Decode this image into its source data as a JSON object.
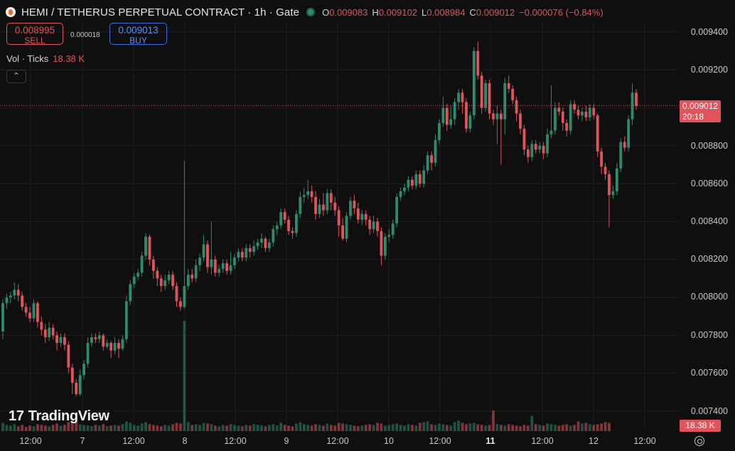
{
  "header": {
    "title": "HEMI / TETHERUS PERPETUAL CONTRACT · 1h · Gate",
    "ohlc": [
      {
        "key": "O",
        "value": "0.009083"
      },
      {
        "key": "H",
        "value": "0.009102"
      },
      {
        "key": "L",
        "value": "0.008984"
      },
      {
        "key": "C",
        "value": "0.009012"
      }
    ],
    "change": "−0.000076 (−0.84%)"
  },
  "trade": {
    "sell_price": "0.008995",
    "sell_label": "SELL",
    "spread": "0.000018",
    "buy_price": "0.009013",
    "buy_label": "BUY"
  },
  "volume_legend": {
    "label": "Vol · Ticks",
    "value": "18.38 K"
  },
  "collapse_icon": "chevron-up-icon",
  "price_axis": {
    "labels": [
      "0.009400",
      "0.009200",
      "0.008800",
      "0.008600",
      "0.008400",
      "0.008200",
      "0.008000",
      "0.007800",
      "0.007600",
      "0.007400"
    ]
  },
  "last_price_tag": {
    "price": "0.009012",
    "countdown": "20:18"
  },
  "volume_tag": "18.38 K",
  "time_axis": {
    "labels": [
      "12:00",
      "7",
      "12:00",
      "8",
      "12:00",
      "9",
      "12:00",
      "10",
      "12:00",
      "11",
      "12:00",
      "12",
      "12:00"
    ]
  },
  "brand": "TradingView",
  "settings_icon": "gear-icon",
  "colors": {
    "up": "#2e8b6e",
    "down": "#e0555c",
    "background": "#0f0f0f",
    "grid": "#1e1e1e"
  },
  "chart_data": {
    "type": "candlestick",
    "title": "HEMI / TETHERUS PERPETUAL CONTRACT · 1h · Gate",
    "ylim": [
      0.0073,
      0.0095
    ],
    "last_price": 0.009012,
    "candles": [
      [
        0.00782,
        0.00797,
        0.00799,
        0.00778
      ],
      [
        0.00797,
        0.008,
        0.00802,
        0.00794
      ],
      [
        0.008,
        0.00801,
        0.00803,
        0.00797
      ],
      [
        0.00801,
        0.00804,
        0.00808,
        0.00799
      ],
      [
        0.00804,
        0.00801,
        0.00807,
        0.00798
      ],
      [
        0.00801,
        0.00795,
        0.00803,
        0.00793
      ],
      [
        0.00795,
        0.00792,
        0.00797,
        0.0079
      ],
      [
        0.00792,
        0.00789,
        0.00795,
        0.00787
      ],
      [
        0.00789,
        0.00797,
        0.00799,
        0.00787
      ],
      [
        0.00797,
        0.00787,
        0.00798,
        0.00784
      ],
      [
        0.00787,
        0.00783,
        0.0079,
        0.0078
      ],
      [
        0.00783,
        0.00779,
        0.00786,
        0.00776
      ],
      [
        0.00779,
        0.00784,
        0.00787,
        0.00777
      ],
      [
        0.00784,
        0.0078,
        0.00786,
        0.00778
      ],
      [
        0.0078,
        0.00776,
        0.00782,
        0.00772
      ],
      [
        0.00776,
        0.00779,
        0.00781,
        0.00774
      ],
      [
        0.00779,
        0.00775,
        0.00781,
        0.00772
      ],
      [
        0.00775,
        0.00763,
        0.00777,
        0.0076
      ],
      [
        0.00763,
        0.00755,
        0.00765,
        0.00749
      ],
      [
        0.00755,
        0.00749,
        0.00757,
        0.00748
      ],
      [
        0.00749,
        0.00759,
        0.00762,
        0.00748
      ],
      [
        0.00759,
        0.00765,
        0.00767,
        0.00757
      ],
      [
        0.00765,
        0.00776,
        0.00779,
        0.00763
      ],
      [
        0.00776,
        0.00779,
        0.00781,
        0.00774
      ],
      [
        0.00779,
        0.00778,
        0.00781,
        0.00776
      ],
      [
        0.00778,
        0.0078,
        0.00782,
        0.00776
      ],
      [
        0.0078,
        0.00774,
        0.00781,
        0.00772
      ],
      [
        0.00774,
        0.00776,
        0.00778,
        0.00773
      ],
      [
        0.00776,
        0.00772,
        0.00777,
        0.00768
      ],
      [
        0.00772,
        0.00776,
        0.00779,
        0.0077
      ],
      [
        0.00776,
        0.00773,
        0.00778,
        0.00768
      ],
      [
        0.00773,
        0.00778,
        0.0078,
        0.00772
      ],
      [
        0.00778,
        0.00798,
        0.00801,
        0.00776
      ],
      [
        0.00798,
        0.00807,
        0.00809,
        0.00796
      ],
      [
        0.00807,
        0.00811,
        0.00813,
        0.00805
      ],
      [
        0.00811,
        0.00813,
        0.00815,
        0.00809
      ],
      [
        0.00813,
        0.00822,
        0.00824,
        0.00811
      ],
      [
        0.00822,
        0.00832,
        0.00834,
        0.0082
      ],
      [
        0.00832,
        0.0082,
        0.00833,
        0.00817
      ],
      [
        0.0082,
        0.00814,
        0.00822,
        0.0081
      ],
      [
        0.00814,
        0.0081,
        0.00816,
        0.00806
      ],
      [
        0.0081,
        0.00806,
        0.00812,
        0.00803
      ],
      [
        0.00806,
        0.00809,
        0.00812,
        0.00804
      ],
      [
        0.00809,
        0.00812,
        0.00814,
        0.00807
      ],
      [
        0.00812,
        0.00806,
        0.00814,
        0.00804
      ],
      [
        0.00806,
        0.00798,
        0.00808,
        0.00795
      ],
      [
        0.00798,
        0.00795,
        0.008,
        0.00793
      ],
      [
        0.00795,
        0.00806,
        0.00872,
        0.00794
      ],
      [
        0.00806,
        0.00812,
        0.00815,
        0.00804
      ],
      [
        0.00812,
        0.0081,
        0.00815,
        0.00808
      ],
      [
        0.0081,
        0.00817,
        0.0082,
        0.00808
      ],
      [
        0.00817,
        0.00821,
        0.00823,
        0.00814
      ],
      [
        0.00821,
        0.00828,
        0.00833,
        0.00819
      ],
      [
        0.00828,
        0.00816,
        0.0083,
        0.00813
      ],
      [
        0.00816,
        0.0082,
        0.0084,
        0.00812
      ],
      [
        0.0082,
        0.00813,
        0.00822,
        0.00811
      ],
      [
        0.00813,
        0.00815,
        0.00817,
        0.00811
      ],
      [
        0.00815,
        0.00818,
        0.0082,
        0.00813
      ],
      [
        0.00818,
        0.00814,
        0.0082,
        0.00812
      ],
      [
        0.00814,
        0.00817,
        0.00824,
        0.00812
      ],
      [
        0.00817,
        0.00821,
        0.00823,
        0.00815
      ],
      [
        0.00821,
        0.00824,
        0.00826,
        0.00819
      ],
      [
        0.00824,
        0.00821,
        0.00826,
        0.00819
      ],
      [
        0.00821,
        0.00826,
        0.00828,
        0.00819
      ],
      [
        0.00826,
        0.00824,
        0.00828,
        0.00821
      ],
      [
        0.00824,
        0.00827,
        0.0083,
        0.00822
      ],
      [
        0.00827,
        0.00829,
        0.00831,
        0.00825
      ],
      [
        0.00829,
        0.00831,
        0.00834,
        0.00826
      ],
      [
        0.00831,
        0.00826,
        0.00832,
        0.00824
      ],
      [
        0.00826,
        0.00829,
        0.00831,
        0.00824
      ],
      [
        0.00829,
        0.00836,
        0.00838,
        0.00827
      ],
      [
        0.00836,
        0.00838,
        0.0084,
        0.00833
      ],
      [
        0.00838,
        0.00845,
        0.00847,
        0.00836
      ],
      [
        0.00845,
        0.00841,
        0.00847,
        0.00839
      ],
      [
        0.00841,
        0.00835,
        0.00843,
        0.00833
      ],
      [
        0.00835,
        0.00834,
        0.00837,
        0.00831
      ],
      [
        0.00834,
        0.00844,
        0.00846,
        0.00832
      ],
      [
        0.00844,
        0.00853,
        0.00856,
        0.00842
      ],
      [
        0.00853,
        0.00854,
        0.00858,
        0.0085
      ],
      [
        0.00854,
        0.00856,
        0.00862,
        0.00852
      ],
      [
        0.00856,
        0.00853,
        0.00859,
        0.0085
      ],
      [
        0.00853,
        0.00844,
        0.00856,
        0.00841
      ],
      [
        0.00844,
        0.00849,
        0.00852,
        0.00842
      ],
      [
        0.00849,
        0.00846,
        0.00855,
        0.00843
      ],
      [
        0.00846,
        0.00855,
        0.00857,
        0.00844
      ],
      [
        0.00855,
        0.0085,
        0.00857,
        0.00846
      ],
      [
        0.0085,
        0.00846,
        0.00853,
        0.00843
      ],
      [
        0.00846,
        0.00838,
        0.00848,
        0.00832
      ],
      [
        0.00838,
        0.00831,
        0.00842,
        0.0083
      ],
      [
        0.00831,
        0.00843,
        0.00845,
        0.00829
      ],
      [
        0.00843,
        0.00851,
        0.00853,
        0.00841
      ],
      [
        0.00851,
        0.00847,
        0.00854,
        0.00844
      ],
      [
        0.00847,
        0.00841,
        0.0085,
        0.00839
      ],
      [
        0.00841,
        0.00844,
        0.00846,
        0.00838
      ],
      [
        0.00844,
        0.00841,
        0.00846,
        0.00838
      ],
      [
        0.00841,
        0.00836,
        0.00843,
        0.00833
      ],
      [
        0.00836,
        0.0084,
        0.00843,
        0.00834
      ],
      [
        0.0084,
        0.00835,
        0.00842,
        0.00832
      ],
      [
        0.00835,
        0.00822,
        0.00837,
        0.00817
      ],
      [
        0.00822,
        0.00832,
        0.00834,
        0.0082
      ],
      [
        0.00832,
        0.00833,
        0.00836,
        0.00829
      ],
      [
        0.00833,
        0.00839,
        0.00841,
        0.00831
      ],
      [
        0.00839,
        0.00853,
        0.00855,
        0.00837
      ],
      [
        0.00853,
        0.00856,
        0.00858,
        0.00851
      ],
      [
        0.00856,
        0.00858,
        0.0086,
        0.00854
      ],
      [
        0.00858,
        0.00862,
        0.00864,
        0.00856
      ],
      [
        0.00862,
        0.00859,
        0.00864,
        0.00857
      ],
      [
        0.00859,
        0.00865,
        0.00867,
        0.00857
      ],
      [
        0.00865,
        0.0086,
        0.00867,
        0.00858
      ],
      [
        0.0086,
        0.00867,
        0.0087,
        0.00858
      ],
      [
        0.00867,
        0.00875,
        0.00877,
        0.00865
      ],
      [
        0.00875,
        0.00871,
        0.00877,
        0.00867
      ],
      [
        0.00871,
        0.00883,
        0.00886,
        0.00869
      ],
      [
        0.00883,
        0.00892,
        0.00894,
        0.00881
      ],
      [
        0.00892,
        0.009,
        0.00906,
        0.0089
      ],
      [
        0.009,
        0.00891,
        0.00902,
        0.00888
      ],
      [
        0.00891,
        0.00894,
        0.00901,
        0.00889
      ],
      [
        0.00894,
        0.00903,
        0.00905,
        0.00891
      ],
      [
        0.00903,
        0.00908,
        0.0091,
        0.00899
      ],
      [
        0.00908,
        0.00903,
        0.0091,
        0.00897
      ],
      [
        0.00903,
        0.00889,
        0.00905,
        0.00887
      ],
      [
        0.00889,
        0.00896,
        0.00898,
        0.00887
      ],
      [
        0.00896,
        0.0093,
        0.00932,
        0.00894
      ],
      [
        0.0093,
        0.00917,
        0.00935,
        0.00915
      ],
      [
        0.00917,
        0.009,
        0.00919,
        0.00897
      ],
      [
        0.009,
        0.00913,
        0.00915,
        0.00898
      ],
      [
        0.00913,
        0.00897,
        0.00915,
        0.00894
      ],
      [
        0.00897,
        0.00894,
        0.00899,
        0.00891
      ],
      [
        0.00894,
        0.00897,
        0.00901,
        0.00881
      ],
      [
        0.00897,
        0.00894,
        0.00899,
        0.0087
      ],
      [
        0.00894,
        0.00913,
        0.00916,
        0.00886
      ],
      [
        0.00913,
        0.0091,
        0.00917,
        0.00908
      ],
      [
        0.0091,
        0.00904,
        0.00912,
        0.00902
      ],
      [
        0.00904,
        0.00897,
        0.00906,
        0.00893
      ],
      [
        0.00897,
        0.00889,
        0.00899,
        0.00886
      ],
      [
        0.00889,
        0.00878,
        0.00891,
        0.00875
      ],
      [
        0.00878,
        0.00874,
        0.0088,
        0.00871
      ],
      [
        0.00874,
        0.00881,
        0.00883,
        0.00872
      ],
      [
        0.00881,
        0.00878,
        0.00883,
        0.00876
      ],
      [
        0.00878,
        0.0088,
        0.00882,
        0.00876
      ],
      [
        0.0088,
        0.00876,
        0.00882,
        0.00873
      ],
      [
        0.00876,
        0.00886,
        0.00889,
        0.00874
      ],
      [
        0.00886,
        0.00888,
        0.00912,
        0.00884
      ],
      [
        0.00888,
        0.009,
        0.00903,
        0.00886
      ],
      [
        0.009,
        0.00898,
        0.00903,
        0.00896
      ],
      [
        0.00898,
        0.00892,
        0.009,
        0.00888
      ],
      [
        0.00892,
        0.00888,
        0.00894,
        0.00885
      ],
      [
        0.00888,
        0.00902,
        0.00904,
        0.00886
      ],
      [
        0.00902,
        0.00899,
        0.00904,
        0.00897
      ],
      [
        0.00899,
        0.00896,
        0.00901,
        0.00894
      ],
      [
        0.00896,
        0.00898,
        0.009,
        0.00893
      ],
      [
        0.00898,
        0.00895,
        0.00901,
        0.00893
      ],
      [
        0.00895,
        0.009,
        0.00902,
        0.00893
      ],
      [
        0.009,
        0.00896,
        0.00902,
        0.00894
      ],
      [
        0.00896,
        0.00877,
        0.00897,
        0.00874
      ],
      [
        0.00877,
        0.00869,
        0.00879,
        0.00865
      ],
      [
        0.00869,
        0.00865,
        0.00871,
        0.00862
      ],
      [
        0.00865,
        0.00854,
        0.00867,
        0.00837
      ],
      [
        0.00854,
        0.00856,
        0.00859,
        0.00852
      ],
      [
        0.00856,
        0.00868,
        0.00871,
        0.00854
      ],
      [
        0.00868,
        0.00882,
        0.00884,
        0.00866
      ],
      [
        0.00882,
        0.00879,
        0.00885,
        0.00877
      ],
      [
        0.00879,
        0.00894,
        0.00896,
        0.00877
      ],
      [
        0.00894,
        0.00908,
        0.00913,
        0.00891
      ],
      [
        0.00908,
        0.00901,
        0.0091,
        0.00899
      ]
    ],
    "volume": [
      12,
      9,
      8,
      10,
      7,
      9,
      6,
      8,
      7,
      10,
      9,
      8,
      7,
      9,
      11,
      8,
      9,
      13,
      15,
      14,
      10,
      9,
      8,
      7,
      9,
      8,
      10,
      7,
      8,
      9,
      8,
      10,
      14,
      12,
      9,
      8,
      11,
      13,
      10,
      9,
      8,
      7,
      9,
      8,
      10,
      12,
      11,
      160,
      13,
      9,
      10,
      9,
      12,
      11,
      10,
      8,
      7,
      9,
      8,
      10,
      9,
      8,
      7,
      9,
      8,
      10,
      9,
      8,
      7,
      9,
      10,
      8,
      12,
      9,
      8,
      7,
      11,
      13,
      10,
      9,
      8,
      10,
      9,
      8,
      11,
      9,
      8,
      12,
      11,
      10,
      9,
      8,
      7,
      8,
      9,
      10,
      9,
      12,
      11,
      8,
      9,
      10,
      11,
      9,
      8,
      10,
      9,
      8,
      12,
      13,
      14,
      10,
      9,
      11,
      10,
      9,
      8,
      13,
      15,
      12,
      10,
      11,
      12,
      10,
      9,
      8,
      9,
      30,
      10,
      9,
      8,
      10,
      9,
      8,
      7,
      9,
      8,
      22,
      10,
      9,
      8,
      11,
      10,
      9,
      8,
      9,
      10,
      8,
      9,
      14,
      11,
      12,
      10,
      9,
      10,
      11,
      13,
      12
    ]
  }
}
